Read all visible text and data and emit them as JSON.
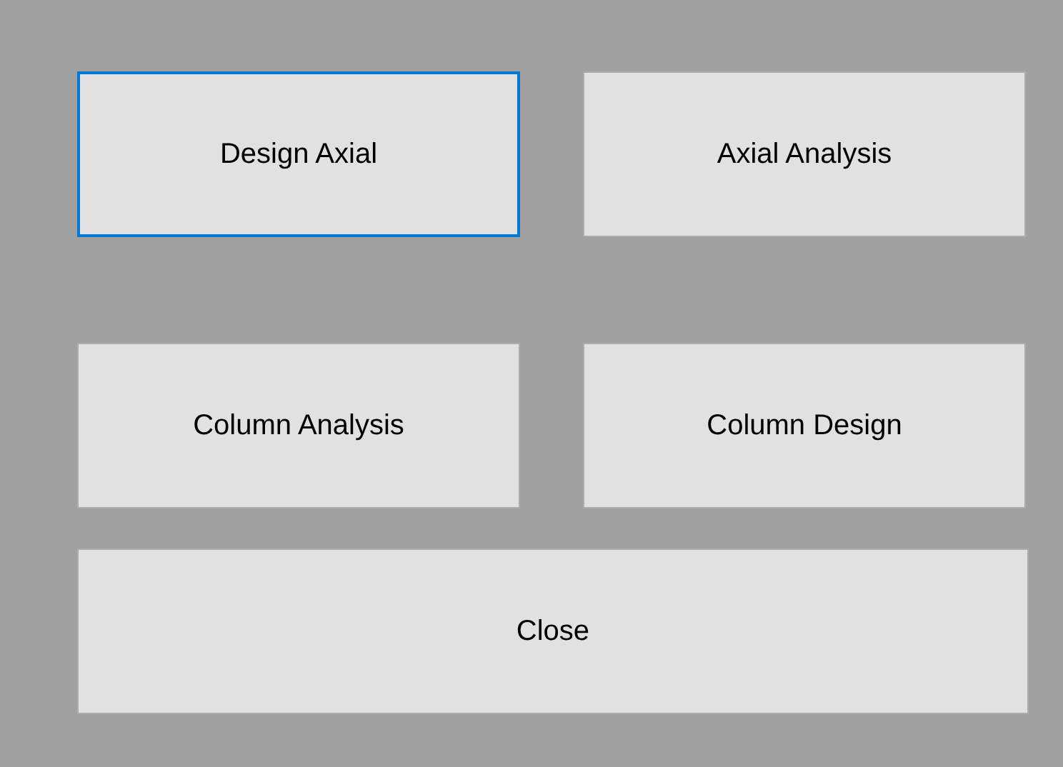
{
  "buttons": [
    {
      "label": "Design Axial",
      "focused": true
    },
    {
      "label": "Axial Analysis",
      "focused": false
    },
    {
      "label": "Column Analysis",
      "focused": false
    },
    {
      "label": "Column Design",
      "focused": false
    }
  ],
  "close_button": {
    "label": "Close",
    "focused": false
  }
}
